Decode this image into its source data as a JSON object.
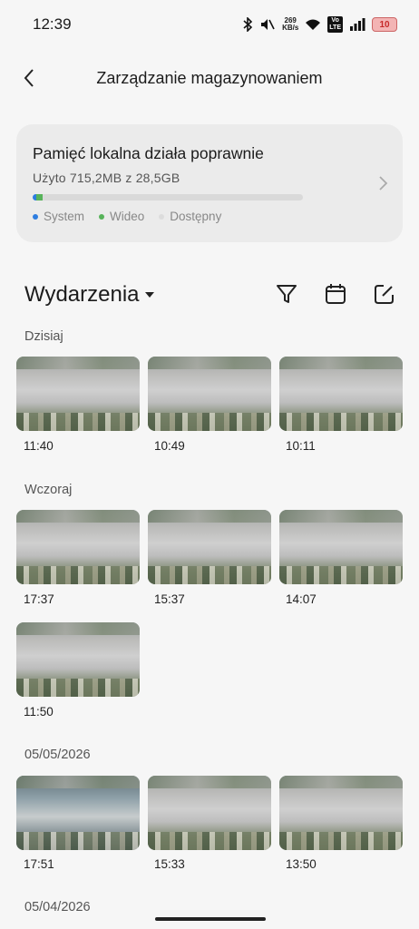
{
  "status_bar": {
    "time": "12:39",
    "net_speed_value": "269",
    "net_speed_unit": "KB/s",
    "volte_line1": "Vo",
    "volte_line2": "LTE",
    "battery": "10",
    "icons": [
      "bluetooth-icon",
      "mute-icon",
      "wifi-icon",
      "signal-icon",
      "battery-icon"
    ]
  },
  "header": {
    "title": "Zarządzanie magazynowaniem",
    "back_icon": "chevron-left-icon"
  },
  "storage": {
    "title": "Pamięć lokalna działa poprawnie",
    "usage": "Użyto 715,2MB z 28,5GB",
    "system_fraction": 0.012,
    "video_fraction": 0.025,
    "legend": [
      {
        "label": "System",
        "color": "#2d7de0"
      },
      {
        "label": "Wideo",
        "color": "#57b35a"
      },
      {
        "label": "Dostępny",
        "color": "#d9d9d9"
      }
    ]
  },
  "events": {
    "title": "Wydarzenia",
    "tools": [
      "filter-icon",
      "calendar-icon",
      "edit-icon"
    ]
  },
  "groups": [
    {
      "label": "Dzisiaj",
      "items": [
        "11:40",
        "10:49",
        "10:11"
      ]
    },
    {
      "label": "Wczoraj",
      "items": [
        "17:37",
        "15:37",
        "14:07",
        "11:50"
      ]
    },
    {
      "label": "05/05/2026",
      "items": [
        "17:51",
        "15:33",
        "13:50"
      ]
    },
    {
      "label": "05/04/2026",
      "items": []
    }
  ],
  "colors": {
    "accent_system": "#2d7de0",
    "accent_video": "#57b35a",
    "background": "#f6f6f6",
    "card": "#ebebeb"
  }
}
